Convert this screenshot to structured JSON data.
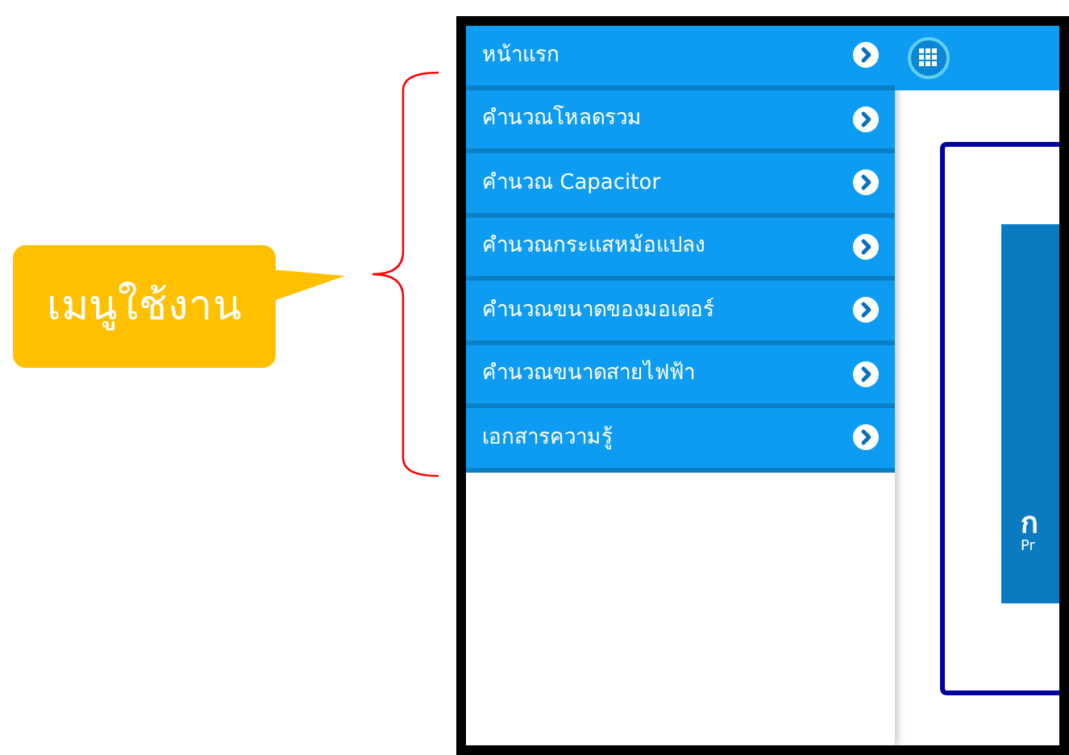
{
  "annotation": {
    "callout": "เมนูใช้งาน"
  },
  "menu": {
    "items": [
      {
        "label": "หน้าแรก"
      },
      {
        "label": "คำนวณโหลดรวม"
      },
      {
        "label": "คำนวณ Capacitor"
      },
      {
        "label": "คำนวณกระแสหม้อแปลง"
      },
      {
        "label": "คำนวณขนาดของมอเตอร์"
      },
      {
        "label": "คำนวณขนาดสายไฟฟ้า"
      },
      {
        "label": "เอกสารความรู้"
      }
    ]
  },
  "content": {
    "banner_title": "ก",
    "banner_subtitle": "Pr"
  }
}
